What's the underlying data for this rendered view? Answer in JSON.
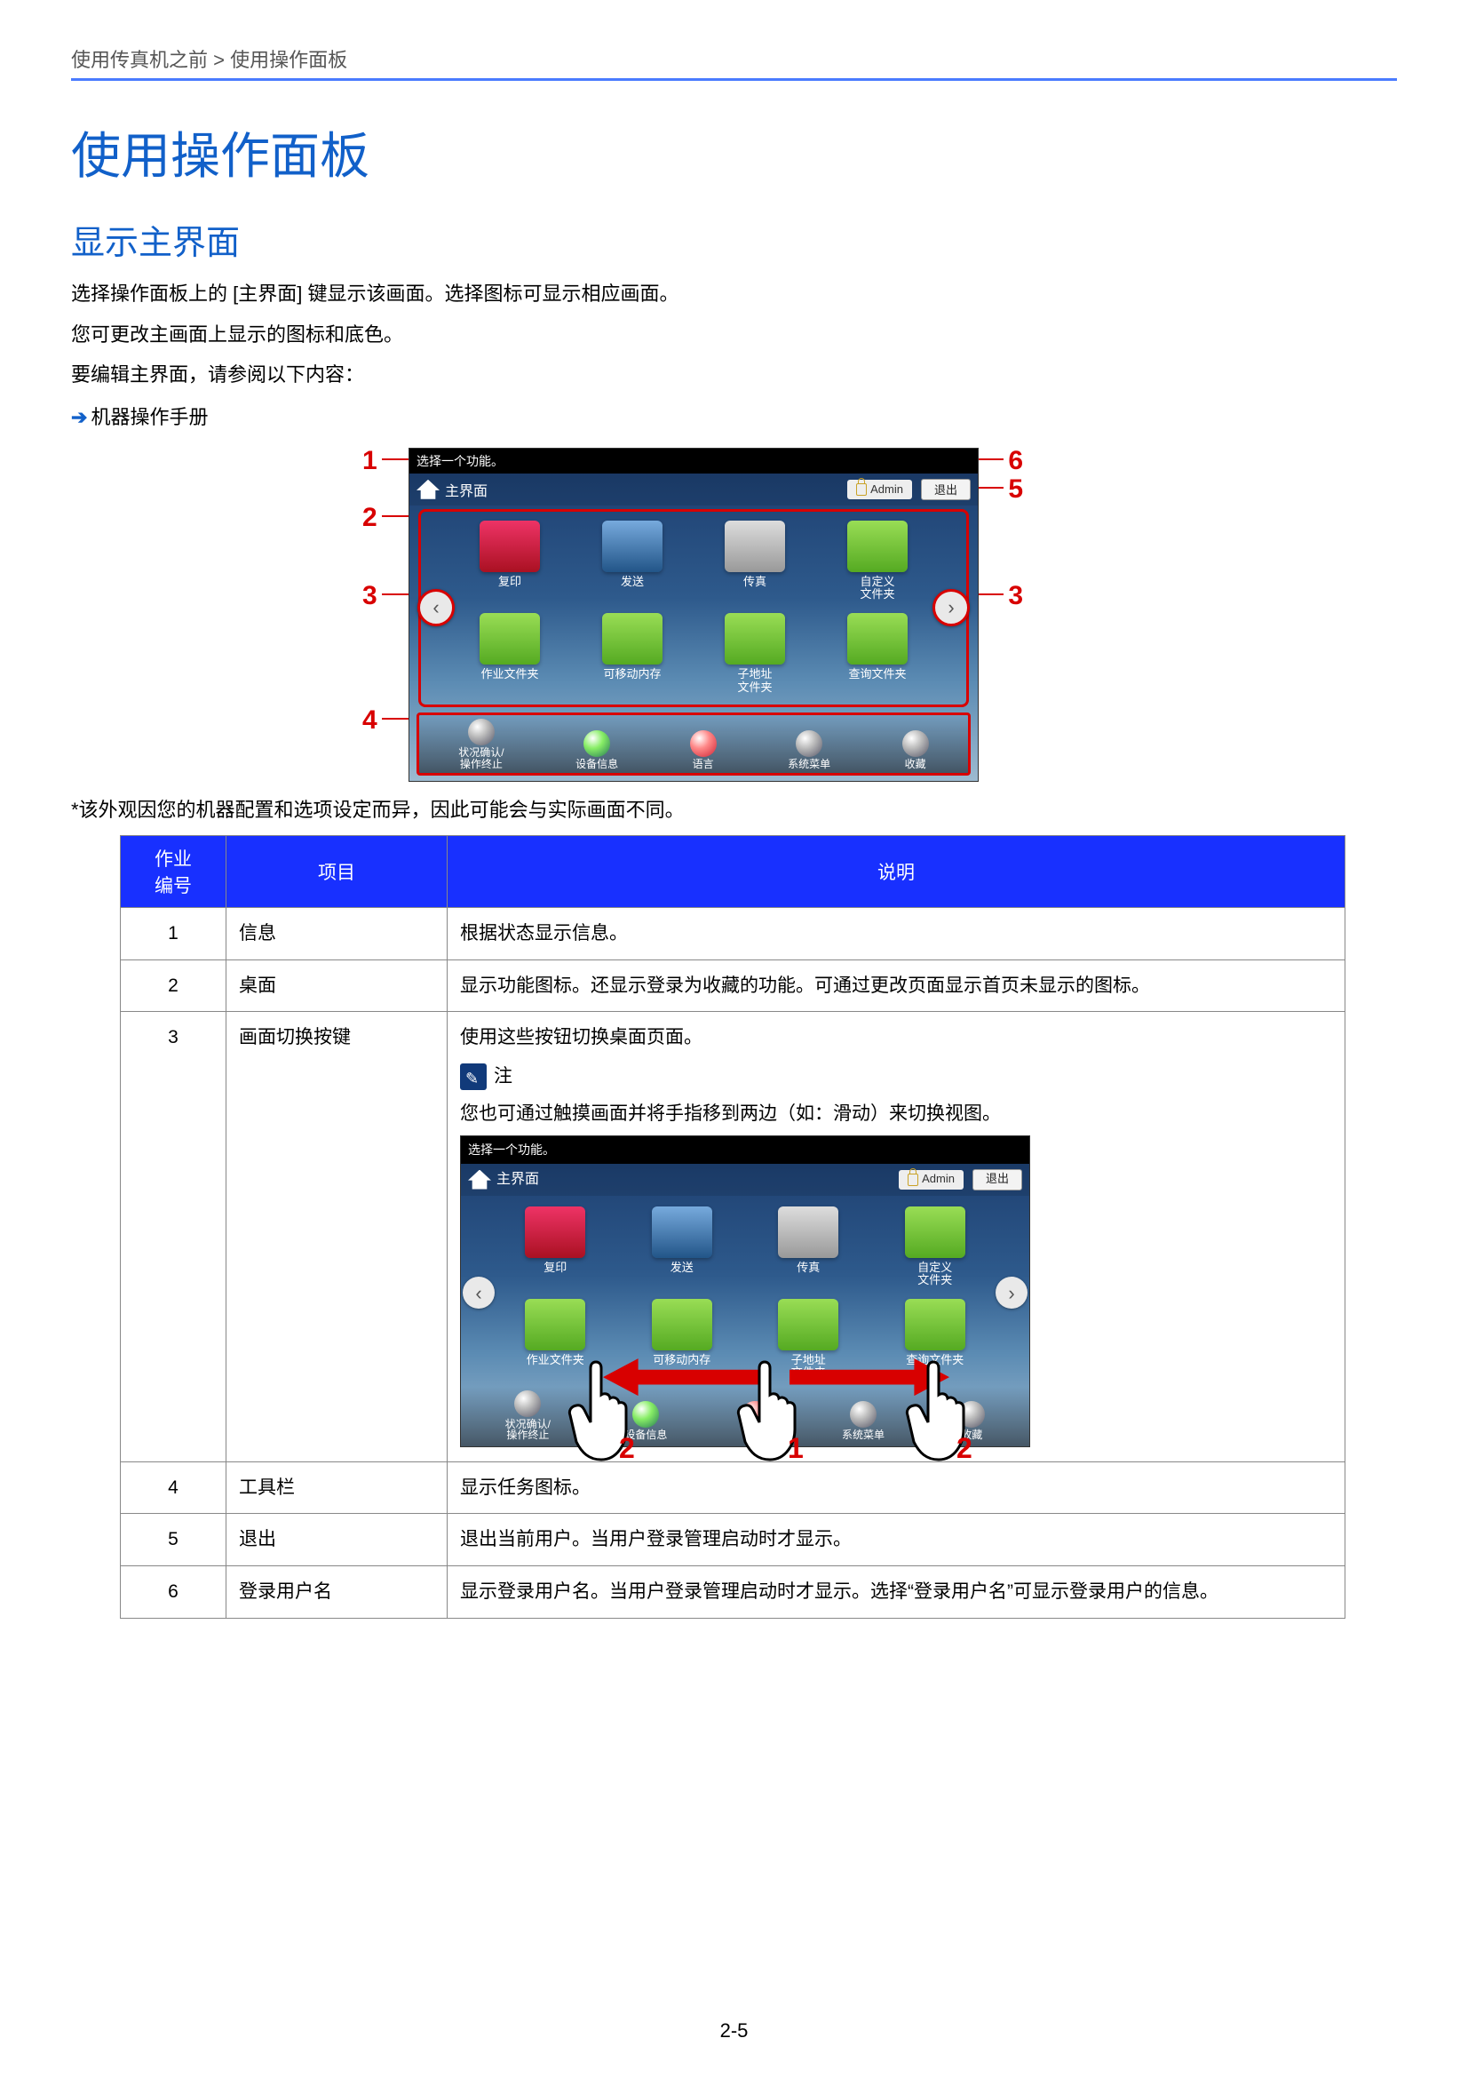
{
  "breadcrumb": "使用传真机之前 > 使用操作面板",
  "h1": "使用操作面板",
  "h2": "显示主界面",
  "para1": "选择操作面板上的 [主界面] 键显示该画面。选择图标可显示相应画面。",
  "para2": "您可更改主画面上显示的图标和底色。",
  "para3": "要编辑主界面，请参阅以下内容：",
  "ref": "机器操作手册",
  "asterisk": "*该外观因您的机器配置和选项设定而异，因此可能会与实际画面不同。",
  "callouts": {
    "c1": "1",
    "c2": "2",
    "c3": "3",
    "c4": "4",
    "c5": "5",
    "c6": "6"
  },
  "screen": {
    "titlebar": "选择一个功能。",
    "topbar_title": "主界面",
    "admin": "Admin",
    "logout": "退出",
    "tiles_row1": [
      {
        "label": "复印",
        "cls": "ic-red"
      },
      {
        "label": "发送",
        "cls": "ic-blue"
      },
      {
        "label": "传真",
        "cls": "ic-gray"
      },
      {
        "label": "自定义\n文件夹",
        "cls": "ic-green"
      }
    ],
    "tiles_row2": [
      {
        "label": "作业文件夹",
        "cls": "ic-green"
      },
      {
        "label": "可移动内存",
        "cls": "ic-green"
      },
      {
        "label": "子地址\n文件夹",
        "cls": "ic-green"
      },
      {
        "label": "查询文件夹",
        "cls": "ic-green"
      }
    ],
    "taskbar": [
      {
        "label": "状况确认/\n操作终止",
        "cls": "td-gray"
      },
      {
        "label": "设备信息",
        "cls": "td-green"
      },
      {
        "label": "语言",
        "cls": "td-red"
      },
      {
        "label": "系统菜单",
        "cls": "td-gray"
      },
      {
        "label": "收藏",
        "cls": "td-gray"
      }
    ]
  },
  "table": {
    "headers": {
      "num": "作业\n编号",
      "item": "项目",
      "desc": "说明"
    },
    "rows": [
      {
        "num": "1",
        "item": "信息",
        "desc": "根据状态显示信息。"
      },
      {
        "num": "2",
        "item": "桌面",
        "desc": "显示功能图标。还显示登录为收藏的功能。可通过更改页面显示首页未显示的图标。"
      },
      {
        "num": "3",
        "item": "画面切换按键",
        "desc": "使用这些按钮切换桌面页面。",
        "note_label": "注",
        "note_body": "您也可通过触摸画面并将手指移到两边（如：滑动）来切换视图。",
        "hands": {
          "left": "2",
          "mid": "1",
          "right": "2"
        }
      },
      {
        "num": "4",
        "item": "工具栏",
        "desc": "显示任务图标。"
      },
      {
        "num": "5",
        "item": "退出",
        "desc": "退出当前用户。当用户登录管理启动时才显示。"
      },
      {
        "num": "6",
        "item": "登录用户名",
        "desc": "显示登录用户名。当用户登录管理启动时才显示。选择“登录用户名”可显示登录用户的信息。"
      }
    ]
  },
  "page_num": "2-5"
}
